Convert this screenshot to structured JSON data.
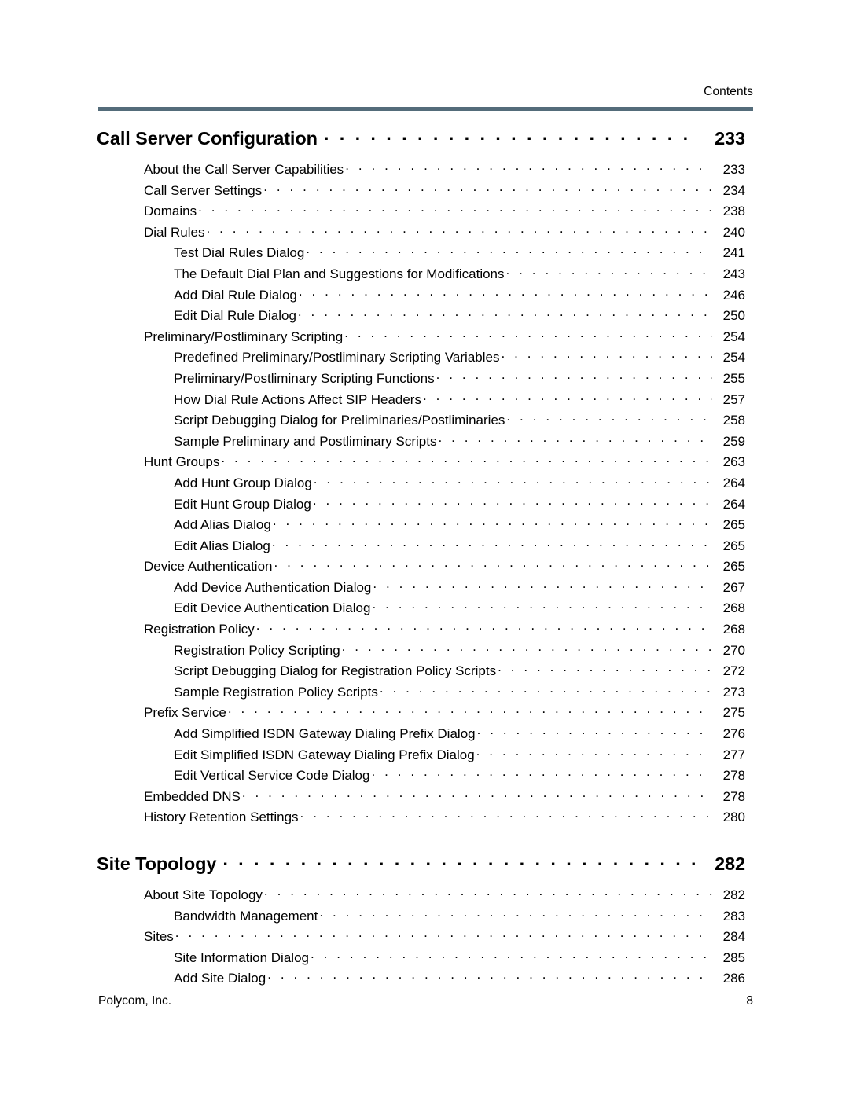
{
  "header": {
    "label": "Contents",
    "rule_color": "#546c7a"
  },
  "footer": {
    "company": "Polycom, Inc.",
    "page_number": "8"
  },
  "toc": {
    "entries": [
      {
        "level": "chapter",
        "title": "Call Server Configuration",
        "page": "233"
      },
      {
        "level": "1",
        "title": "About the Call Server Capabilities",
        "page": "233"
      },
      {
        "level": "1",
        "title": "Call Server Settings",
        "page": "234"
      },
      {
        "level": "1",
        "title": "Domains",
        "page": "238"
      },
      {
        "level": "1",
        "title": "Dial Rules",
        "page": "240"
      },
      {
        "level": "2",
        "title": "Test Dial Rules Dialog",
        "page": "241"
      },
      {
        "level": "2",
        "title": "The Default Dial Plan and Suggestions for Modifications",
        "page": "243"
      },
      {
        "level": "2",
        "title": "Add Dial Rule Dialog",
        "page": "246"
      },
      {
        "level": "2",
        "title": "Edit Dial Rule Dialog",
        "page": "250"
      },
      {
        "level": "1",
        "title": "Preliminary/Postliminary Scripting",
        "page": "254"
      },
      {
        "level": "2",
        "title": "Predefined Preliminary/Postliminary Scripting Variables",
        "page": "254"
      },
      {
        "level": "2",
        "title": "Preliminary/Postliminary Scripting Functions",
        "page": "255"
      },
      {
        "level": "2",
        "title": "How Dial Rule Actions Affect SIP Headers",
        "page": "257"
      },
      {
        "level": "2",
        "title": "Script Debugging Dialog for Preliminaries/Postliminaries",
        "page": "258"
      },
      {
        "level": "2",
        "title": "Sample Preliminary and Postliminary Scripts",
        "page": "259"
      },
      {
        "level": "1",
        "title": "Hunt Groups",
        "page": "263"
      },
      {
        "level": "2",
        "title": "Add Hunt Group Dialog",
        "page": "264"
      },
      {
        "level": "2",
        "title": "Edit Hunt Group Dialog",
        "page": "264"
      },
      {
        "level": "2",
        "title": "Add Alias Dialog",
        "page": "265"
      },
      {
        "level": "2",
        "title": "Edit Alias Dialog",
        "page": "265"
      },
      {
        "level": "1",
        "title": "Device Authentication",
        "page": "265"
      },
      {
        "level": "2",
        "title": "Add Device Authentication Dialog",
        "page": "267"
      },
      {
        "level": "2",
        "title": "Edit Device Authentication Dialog",
        "page": "268"
      },
      {
        "level": "1",
        "title": "Registration Policy",
        "page": "268"
      },
      {
        "level": "2",
        "title": "Registration Policy Scripting",
        "page": "270"
      },
      {
        "level": "2",
        "title": "Script Debugging Dialog for Registration Policy Scripts",
        "page": "272"
      },
      {
        "level": "2",
        "title": "Sample Registration Policy Scripts",
        "page": "273"
      },
      {
        "level": "1",
        "title": "Prefix Service",
        "page": "275"
      },
      {
        "level": "2",
        "title": "Add Simplified ISDN Gateway Dialing Prefix Dialog",
        "page": "276"
      },
      {
        "level": "2",
        "title": "Edit Simplified ISDN Gateway Dialing Prefix Dialog",
        "page": "277"
      },
      {
        "level": "2",
        "title": "Edit Vertical Service Code Dialog",
        "page": "278"
      },
      {
        "level": "1",
        "title": "Embedded DNS",
        "page": "278"
      },
      {
        "level": "1",
        "title": "History Retention Settings",
        "page": "280"
      },
      {
        "level": "spacer",
        "title": "",
        "page": ""
      },
      {
        "level": "chapter",
        "title": "Site Topology",
        "page": "282"
      },
      {
        "level": "1",
        "title": "About Site Topology",
        "page": "282"
      },
      {
        "level": "2",
        "title": "Bandwidth Management",
        "page": "283"
      },
      {
        "level": "1",
        "title": "Sites",
        "page": "284"
      },
      {
        "level": "2",
        "title": "Site Information Dialog",
        "page": "285"
      },
      {
        "level": "2",
        "title": "Add Site Dialog",
        "page": "286"
      }
    ]
  }
}
